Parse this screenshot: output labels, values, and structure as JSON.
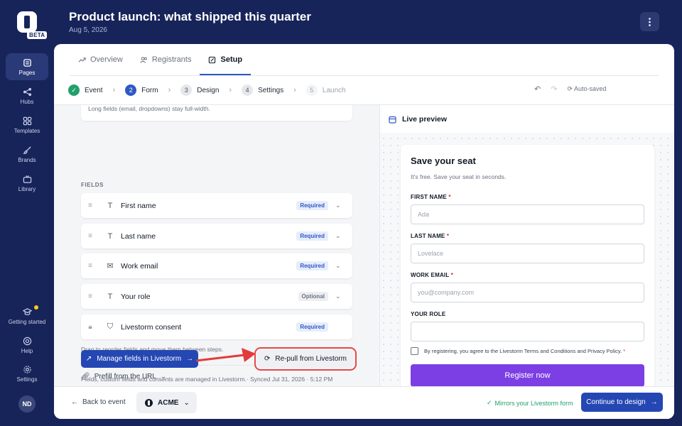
{
  "rail": {
    "beta": "BETA",
    "items": [
      {
        "label": "Pages",
        "icon": "pages-icon"
      },
      {
        "label": "Hubs",
        "icon": "share-icon"
      },
      {
        "label": "Templates",
        "icon": "grid-icon"
      },
      {
        "label": "Brands",
        "icon": "brush-icon"
      },
      {
        "label": "Library",
        "icon": "tv-icon"
      },
      {
        "label": "Getting started",
        "icon": "cap-icon"
      },
      {
        "label": "Help",
        "icon": "help-icon"
      },
      {
        "label": "Settings",
        "icon": "gear-icon"
      }
    ],
    "avatar": "ND"
  },
  "header": {
    "title": "Product launch: what shipped this quarter",
    "date": "Aug 5, 2026"
  },
  "tabs": [
    {
      "label": "Overview",
      "icon": "trend-icon"
    },
    {
      "label": "Registrants",
      "icon": "users-icon"
    },
    {
      "label": "Setup",
      "icon": "edit-icon",
      "active": true
    }
  ],
  "steps": [
    {
      "num": "✓",
      "label": "Event",
      "state": "done"
    },
    {
      "num": "2",
      "label": "Form",
      "state": "current"
    },
    {
      "num": "3",
      "label": "Design",
      "state": "todo"
    },
    {
      "num": "4",
      "label": "Settings",
      "state": "todo"
    },
    {
      "num": "5",
      "label": "Launch",
      "state": "muted"
    }
  ],
  "toolbar": {
    "autosaved": "Auto-saved"
  },
  "left": {
    "prev_note": "Long fields (email, dropdowns) stay full-width.",
    "fields_label": "FIELDS",
    "fields": [
      {
        "name": "First name",
        "badge": "Required",
        "type_icon": "T"
      },
      {
        "name": "Last name",
        "badge": "Required",
        "type_icon": "T"
      },
      {
        "name": "Work email",
        "badge": "Required",
        "type_icon": "✉"
      },
      {
        "name": "Your role",
        "badge": "Optional",
        "type_icon": "T"
      },
      {
        "name": "Livestorm consent",
        "badge": "Required",
        "type_icon": "⛉"
      }
    ],
    "hint": "Drag to reorder fields and move them between steps.",
    "prefill": "Prefill from the URL",
    "manage_button": "Manage fields in Livestorm",
    "repull_button": "Re-pull from Livestorm",
    "managed_note": "Fields, custom fields and consents are managed in Livestorm.· Synced Jul 31, 2026 · 5:12 PM"
  },
  "preview": {
    "header": "Live preview",
    "title": "Save your seat",
    "subtitle": "It's free. Save your seat in seconds.",
    "fields": [
      {
        "label": "FIRST NAME",
        "required": "*",
        "placeholder": "Ada"
      },
      {
        "label": "LAST NAME",
        "required": "*",
        "placeholder": "Lovelace"
      },
      {
        "label": "WORK EMAIL",
        "required": "*",
        "placeholder": "you@company.com"
      },
      {
        "label": "YOUR ROLE",
        "required": "",
        "placeholder": ""
      }
    ],
    "consent": "By registering, you agree to the Livestorm Terms and Conditions and Privacy Policy.",
    "consent_req": "*",
    "register": "Register now"
  },
  "footer": {
    "back": "Back to event",
    "org": "ACME",
    "mirrors": "Mirrors your Livestorm form",
    "continue": "Continue to design"
  }
}
